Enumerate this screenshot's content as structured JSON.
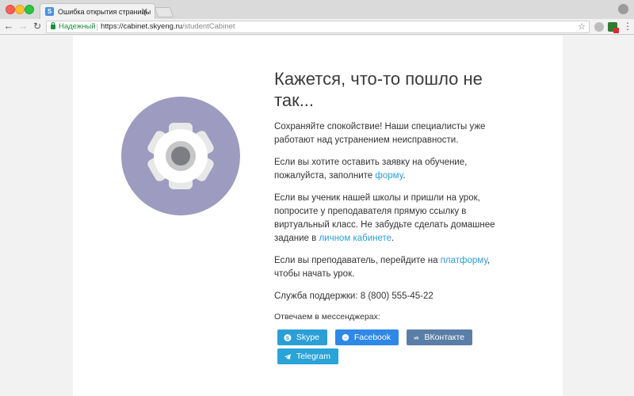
{
  "browser": {
    "tab_title": "Ошибка открытия страницы",
    "tab_favicon": "S",
    "tab_close": "✕",
    "secure_label": "Надежный",
    "url_host": "https://cabinet.skyeng.ru",
    "url_path": "/studentCabinet",
    "icons": {
      "back": "back-arrow-icon",
      "forward": "forward-arrow-icon",
      "reload": "reload-icon",
      "lock": "lock-icon",
      "star": "star-icon",
      "menu": "menu-dots-icon"
    }
  },
  "error_page": {
    "title": "Кажется, что-то пошло не так...",
    "para1": "Сохраняйте спокойствие! Наши специалисты уже работают над устранением неисправности.",
    "para2_pre": "Если вы хотите оставить заявку на обучение, пожалуйста, заполните ",
    "para2_link": "форму",
    "para2_post": ".",
    "para3_pre": "Если вы ученик нашей школы и пришли на урок, попросите у преподавателя прямую ссылку в виртуальный класс. Не забудьте сделать домашнее задание в ",
    "para3_link": "личном кабинете",
    "para3_post": ".",
    "para4_pre": "Если вы преподаватель, перейдите на ",
    "para4_link": "платформу",
    "para4_post": ", чтобы начать урок.",
    "support": "Служба поддержки: 8 (800) 555-45-22",
    "messengers_label": "Отвечаем в мессенджерах:",
    "buttons": {
      "skype": "Skype",
      "facebook": "Facebook",
      "vk": "ВКонтакте",
      "telegram": "Telegram"
    }
  },
  "colors": {
    "gear_circle": "#9d9bbf",
    "link": "#2a9fd6",
    "skype": "#2a9fd6",
    "facebook": "#2e88e6",
    "vk": "#5b7ea6",
    "telegram": "#2aa3d8"
  }
}
